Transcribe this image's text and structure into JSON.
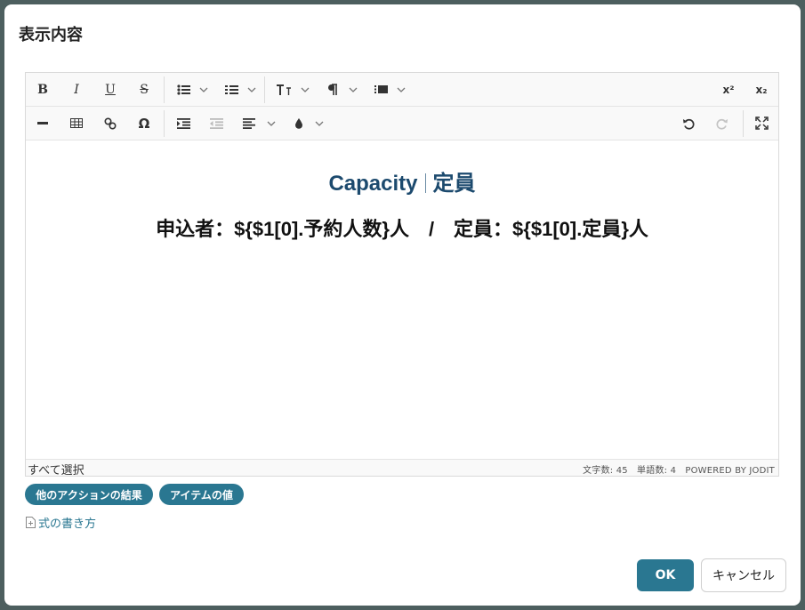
{
  "dialog": {
    "title": "表示内容"
  },
  "toolbar": {
    "bold_label": "B",
    "italic_label": "I",
    "underline_label": "U",
    "strike_label": "S",
    "superscript_label": "x²",
    "subscript_label": "x₂"
  },
  "content": {
    "heading_en": "Capacity",
    "heading_ja": "定員",
    "line": "申込者：${$1[0].予約人数}人　/　定員：${$1[0].定員}人"
  },
  "status": {
    "select_all": "すべて選択",
    "stats": "文字数: 45　単語数: 4　POWERED BY JODIT"
  },
  "chips": {
    "action_result": "他のアクションの結果",
    "item_value": "アイテムの値"
  },
  "help": {
    "formula_link": "式の書き方"
  },
  "footer": {
    "ok": "OK",
    "cancel": "キャンセル"
  },
  "colors": {
    "accent": "#2a7791",
    "heading": "#1c4a6e"
  }
}
